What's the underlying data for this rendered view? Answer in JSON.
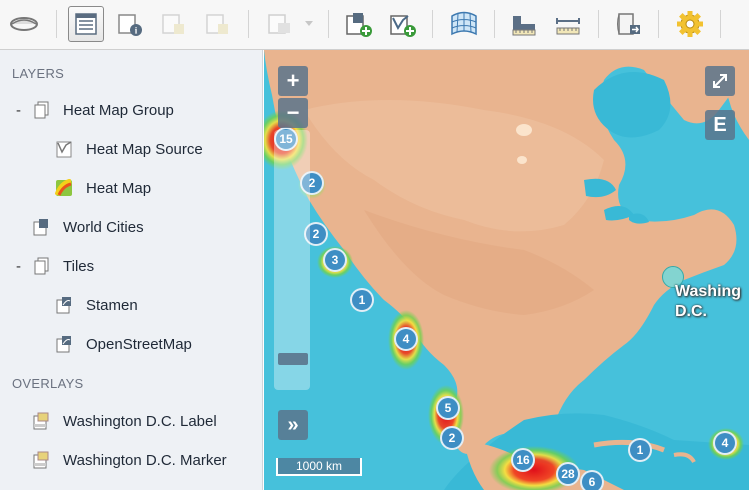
{
  "toolbar": {
    "buttons": [
      {
        "icon": "map-view-icon"
      },
      {
        "icon": "layer-table-icon",
        "active": true
      },
      {
        "icon": "layer-info-icon"
      },
      {
        "icon": "move-up-icon"
      },
      {
        "icon": "move-down-icon"
      },
      {
        "icon": "style-dropdown-icon"
      },
      {
        "icon": "add-layer-icon"
      },
      {
        "icon": "add-vector-layer-icon"
      },
      {
        "icon": "projection-grid-icon"
      },
      {
        "icon": "measure-area-icon"
      },
      {
        "icon": "measure-length-icon"
      },
      {
        "icon": "export-map-icon"
      },
      {
        "icon": "settings-gear-icon"
      }
    ]
  },
  "sidebar": {
    "layers_title": "LAYERS",
    "overlays_title": "OVERLAYS",
    "layers": [
      {
        "label": "Heat Map Group",
        "toggle": "-",
        "icon": "group-icon",
        "indent": 0
      },
      {
        "label": "Heat Map Source",
        "icon": "vector-source-icon",
        "indent": 1
      },
      {
        "label": "Heat Map",
        "icon": "heatmap-icon",
        "indent": 1
      },
      {
        "label": "World Cities",
        "icon": "point-layer-icon",
        "indent": 0
      },
      {
        "label": "Tiles",
        "toggle": "-",
        "icon": "group-icon",
        "indent": 0
      },
      {
        "label": "Stamen",
        "icon": "tile-layer-icon",
        "indent": 1
      },
      {
        "label": "OpenStreetMap",
        "icon": "tile-layer-icon",
        "indent": 1
      }
    ],
    "overlays": [
      {
        "label": "Washington D.C. Label",
        "icon": "overlay-icon"
      },
      {
        "label": "Washington D.C. Marker",
        "icon": "overlay-icon"
      }
    ]
  },
  "map": {
    "zoom_in": "+",
    "zoom_out": "−",
    "expand": "»",
    "fullscreen_icon": "fullscreen-icon",
    "extent_button": "E",
    "scale": "1000 km",
    "dc_label_line1": "Washing",
    "dc_label_line2": "D.C.",
    "clusters": [
      "15",
      "2",
      "2",
      "3",
      "1",
      "4",
      "5",
      "2",
      "16",
      "28",
      "6",
      "1",
      "4"
    ],
    "colors": {
      "water": "#39b9d6",
      "land": "#e6b08a",
      "cluster": "#3e8ec4",
      "heat_core": "#e0101a"
    }
  }
}
